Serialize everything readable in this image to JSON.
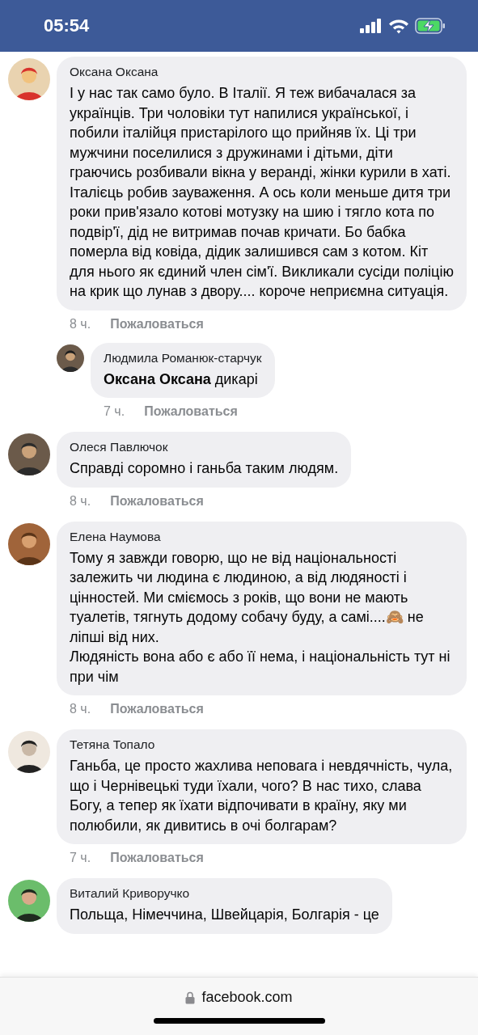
{
  "status_bar": {
    "time": "05:54",
    "charging": true
  },
  "comments": [
    {
      "author": "Оксана Оксана",
      "text": "І у нас так само було. В Італії. Я теж вибачалася за українців. Три чоловіки тут напилися української, і побили італійця пристарілого що прийняв їх. Ці три мужчини поселилися з дружинами і дітьми, діти граючись розбивали вікна у веранді, жінки курили в хаті. Італієць робив зауваження. А ось коли меньше дитя три роки прив'язало котові мотузку на шию і тягло кота по подвір'ї, дід не витримав почав кричати. Бо бабка померла від ковіда, дідик залишився сам з котом. Кіт для нього як єдиний член сім'ї. Викликали сусіди поліцію на крик що лунав з двору.... короче неприємна ситуація.",
      "time": "8 ч.",
      "action": "Пожаловаться",
      "replies": [
        {
          "author": "Людмила Романюк-старчук",
          "text": "**Оксана Оксана** дикарі",
          "time": "7 ч.",
          "action": "Пожаловаться"
        }
      ]
    },
    {
      "author": "Олеся Павлючок",
      "text": "Справді соромно і ганьба таким людям.",
      "time": "8 ч.",
      "action": "Пожаловаться"
    },
    {
      "author": "Елена Наумова",
      "text": "Тому я завжди говорю, що не від національності залежить чи людина є людиною, а від людяності і цінностей. Ми сміємось з років, що вони не мають туалетів, тягнуть додому собачу буду, а самі....🙈 не ліпші від них.\nЛюдяність вона або є або її нема, і національність тут ні при чім",
      "time": "8 ч.",
      "action": "Пожаловаться"
    },
    {
      "author": "Тетяна Топало",
      "text": "Ганьба, це просто жахлива неповага і невдячність, чула, що і Чернівецькі туди їхали, чого? В нас тихо, слава Богу, а тепер як їхати відпочивати в країну, яку ми полюбили, як дивитись в очі болгарам?",
      "time": "7 ч.",
      "action": "Пожаловаться"
    },
    {
      "author": "Виталий Криворучко",
      "text": "Польща, Німеччина, Швейцарія, Болгарія - це"
    }
  ],
  "address_bar": {
    "url": "facebook.com",
    "secure": true
  }
}
